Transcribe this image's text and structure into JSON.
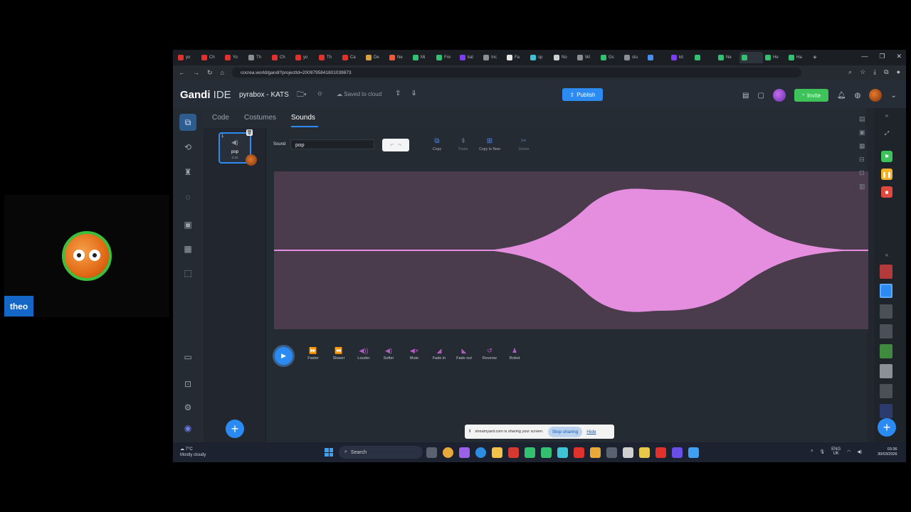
{
  "participant": {
    "name": "theo"
  },
  "browser": {
    "tabs": [
      {
        "label": "yo",
        "color": "#e0312d"
      },
      {
        "label": "Ch",
        "color": "#e0312d"
      },
      {
        "label": "Yo",
        "color": "#e0312d"
      },
      {
        "label": "Th",
        "color": "#8a8f96"
      },
      {
        "label": "Ch",
        "color": "#e0312d"
      },
      {
        "label": "yo",
        "color": "#e0312d"
      },
      {
        "label": "Th",
        "color": "#e0312d"
      },
      {
        "label": "Ca",
        "color": "#e0312d"
      },
      {
        "label": "De",
        "color": "#d6a142"
      },
      {
        "label": "Ne",
        "color": "#ef5a3a"
      },
      {
        "label": "Mi",
        "color": "#33c071"
      },
      {
        "label": "Fre",
        "color": "#33c071"
      },
      {
        "label": "kal",
        "color": "#7b3ef3"
      },
      {
        "label": "Inc",
        "color": "#8a8f96"
      },
      {
        "label": "Fa",
        "color": "#e8e8e8"
      },
      {
        "label": "sp",
        "color": "#3ec3d6"
      },
      {
        "label": "No",
        "color": "#cfcfcf"
      },
      {
        "label": "Wi",
        "color": "#8a8f96"
      },
      {
        "label": "Gs",
        "color": "#33c071"
      },
      {
        "label": "stu",
        "color": "#8a8f96"
      },
      {
        "label": "",
        "color": "#4b8cf0"
      },
      {
        "label": "kit",
        "color": "#7b3ef3"
      },
      {
        "label": "",
        "color": "#33c071"
      },
      {
        "label": "Ne",
        "color": "#33c071"
      },
      {
        "label": "",
        "color": "#33c071"
      },
      {
        "label": "He",
        "color": "#33c071"
      },
      {
        "label": "Ha",
        "color": "#33c071"
      }
    ],
    "url": "cocrea.world/gandi?projectId=2009795841801039873"
  },
  "header": {
    "logo_main": "Gandi",
    "logo_sub": " IDE",
    "project_name": "pyrabox - KATS",
    "saved_text": "Saved to cloud",
    "publish_label": "Publish",
    "invite_label": "Invite"
  },
  "editor": {
    "tabs": [
      "Code",
      "Costumes",
      "Sounds"
    ],
    "active_tab": "Sounds",
    "sound_card": {
      "index": "1",
      "name": "pop",
      "duration": "0.15"
    },
    "sound_field_label": "Sound",
    "sound_name_value": "pop",
    "tools": [
      "Copy",
      "Paste",
      "Copy to New",
      "Delete"
    ],
    "effects": [
      "Faster",
      "Slower",
      "Louder",
      "Softer",
      "Mute",
      "Fade in",
      "Fade out",
      "Reverse",
      "Robot"
    ],
    "waveform_color": "#e58ddf",
    "waveform_bg": "#4a3b4d"
  },
  "share_bar": {
    "message": "streamyard.com is sharing your screen.",
    "stop_label": "Stop sharing",
    "hide_label": "Hide"
  },
  "taskbar": {
    "temperature": "7°C",
    "weather": "Mostly cloudy",
    "search_label": "Search",
    "lang_1": "ENG",
    "lang_2": "UK",
    "time": "03:36",
    "date": "30/03/2026"
  }
}
